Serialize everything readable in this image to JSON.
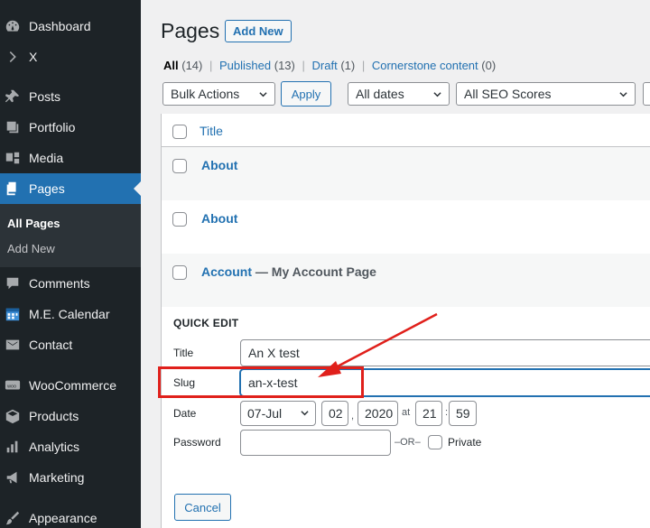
{
  "sidebar": {
    "items": [
      {
        "label": "Dashboard",
        "icon": "dashboard-icon"
      },
      {
        "label": "X",
        "icon": "chevron-right-icon"
      },
      {
        "label": "Posts",
        "icon": "pushpin-icon"
      },
      {
        "label": "Portfolio",
        "icon": "portfolio-icon"
      },
      {
        "label": "Media",
        "icon": "media-icon"
      },
      {
        "label": "Pages",
        "icon": "pages-icon"
      },
      {
        "label": "Comments",
        "icon": "comments-icon"
      },
      {
        "label": "M.E. Calendar",
        "icon": "calendar-icon"
      },
      {
        "label": "Contact",
        "icon": "envelope-icon"
      },
      {
        "label": "WooCommerce",
        "icon": "woocommerce-icon"
      },
      {
        "label": "Products",
        "icon": "box-icon"
      },
      {
        "label": "Analytics",
        "icon": "bar-chart-icon"
      },
      {
        "label": "Marketing",
        "icon": "megaphone-icon"
      },
      {
        "label": "Appearance",
        "icon": "paintbrush-icon"
      }
    ],
    "submenu": {
      "all_pages": "All Pages",
      "add_new": "Add New"
    },
    "colors": {
      "background": "#1d2327",
      "active": "#2271b1"
    }
  },
  "header": {
    "title": "Pages",
    "add_new": "Add New"
  },
  "filters": {
    "all": "All",
    "all_count": "(14)",
    "published": "Published",
    "published_count": "(13)",
    "draft": "Draft",
    "draft_count": "(1)",
    "cornerstone": "Cornerstone content",
    "cornerstone_count": "(0)",
    "separator": "|"
  },
  "toolbar": {
    "bulk_actions": "Bulk Actions",
    "apply": "Apply",
    "dates": "All dates",
    "seo": "All SEO Scores"
  },
  "table": {
    "column_title": "Title",
    "rows": [
      {
        "title": "About",
        "state": ""
      },
      {
        "title": "About",
        "state": ""
      },
      {
        "title": "Account",
        "state": "— My Account Page"
      }
    ]
  },
  "quick_edit": {
    "heading": "QUICK EDIT",
    "title_label": "Title",
    "title_value": "An X test",
    "slug_label": "Slug",
    "slug_value": "an-x-test",
    "date_label": "Date",
    "month": "07-Jul",
    "day": "02",
    "year": "2020",
    "at": "at",
    "hour": "21",
    "minute": "59",
    "comma": ",",
    "colon": ":",
    "password_label": "Password",
    "or": "–OR–",
    "private_label": "Private",
    "cancel": "Cancel"
  },
  "annotation": {
    "color": "#e0201b"
  }
}
